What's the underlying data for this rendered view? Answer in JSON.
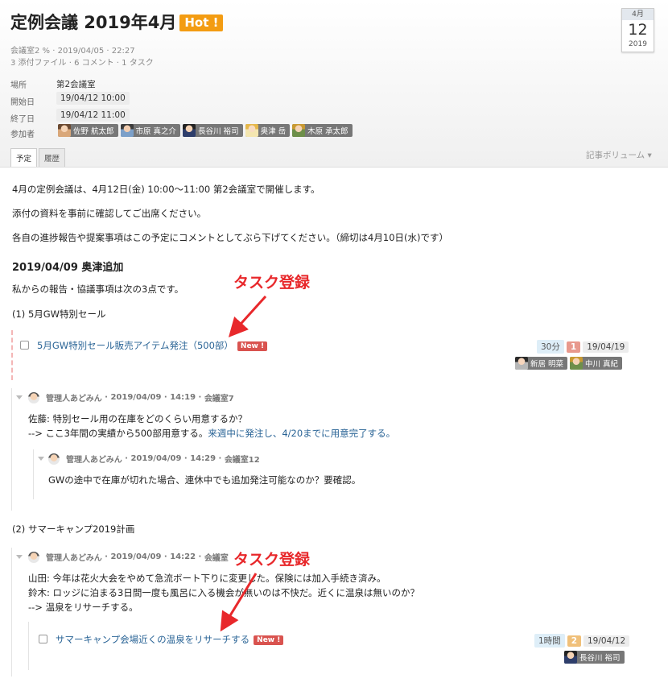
{
  "event": {
    "title": "定例会議 2019年4月",
    "hot_badge": "Hot !",
    "meta_line1": "会議室2 % · 2019/04/05 · 22:27",
    "meta_line2": "3 添付ファイル · 6 コメント · 1 タスク"
  },
  "calendar": {
    "month": "4月",
    "day": "12",
    "year": "2019"
  },
  "fields": {
    "place_label": "場所",
    "place_value": "第2会議室",
    "start_label": "開始日",
    "start_value": "19/04/12 10:00",
    "end_label": "終了日",
    "end_value": "19/04/12 11:00",
    "participants_label": "参加者"
  },
  "participants": [
    "佐野 航太郎",
    "市原 真之介",
    "長谷川 裕司",
    "奥津 岳",
    "木原 承太郎"
  ],
  "tabs": [
    "予定",
    "履歴"
  ],
  "volume_label": "記事ボリューム ▾",
  "body": {
    "p1": "4月の定例会議は、4月12日(金) 10:00〜11:00 第2会議室で開催します。",
    "p2": "添付の資料を事前に確認してご出席ください。",
    "p3": "各自の進捗報告や提案事項はこの予定にコメントとしてぶら下げてください。（締切は4月10日(水)です）",
    "heading": "2019/04/09 奥津追加",
    "p4": "私からの報告・協議事項は次の3点です。",
    "item1": "(1) 5月GW特別セール",
    "item2": "(2) サマーキャンプ2019計画"
  },
  "task1": {
    "title": "5月GW特別セール販売アイテム発注（500部）",
    "new_label": "New !",
    "estimate": "30分",
    "count": "1",
    "due": "19/04/19",
    "assignees": [
      "新居 明菜",
      "中川 真紀"
    ]
  },
  "comment1": {
    "author": "管理人あどみん",
    "date": "2019/04/09",
    "time": "14:19",
    "room": "会議室7",
    "line1": "佐藤: 特別セール用の在庫をどのくらい用意するか？",
    "line2_prefix": "--> ここ3年間の実績から500部用意する。",
    "line2_link": "来週中に発注し、4/20までに用意完了する。"
  },
  "comment2": {
    "author": "管理人あどみん",
    "date": "2019/04/09",
    "time": "14:29",
    "room": "会議室12",
    "line1": "GWの途中で在庫が切れた場合、連休中でも追加発注可能なのか？要確認。"
  },
  "comment3": {
    "author": "管理人あどみん",
    "date": "2019/04/09",
    "time": "14:22",
    "room": "会議室",
    "line1": "山田: 今年は花火大会をやめて急流ボート下りに変更した。保険には加入手続き済み。",
    "line2": "鈴木: ロッジに泊まる3日間一度も風呂に入る機会が無いのは不快だ。近くに温泉は無いのか？",
    "line3": "--> 温泉をリサーチする。"
  },
  "task2": {
    "title": "サマーキャンプ会場近くの温泉をリサーチする",
    "new_label": "New !",
    "estimate": "1時間",
    "count": "2",
    "due": "19/04/12",
    "assignees": [
      "長谷川 裕司"
    ]
  },
  "annotations": {
    "a1": "タスク登録",
    "a2": "タスク登録"
  },
  "colors": {
    "hot": "#f39c12",
    "new_badge": "#d9534f",
    "annotation": "#e8282b",
    "link": "#2a6496"
  }
}
